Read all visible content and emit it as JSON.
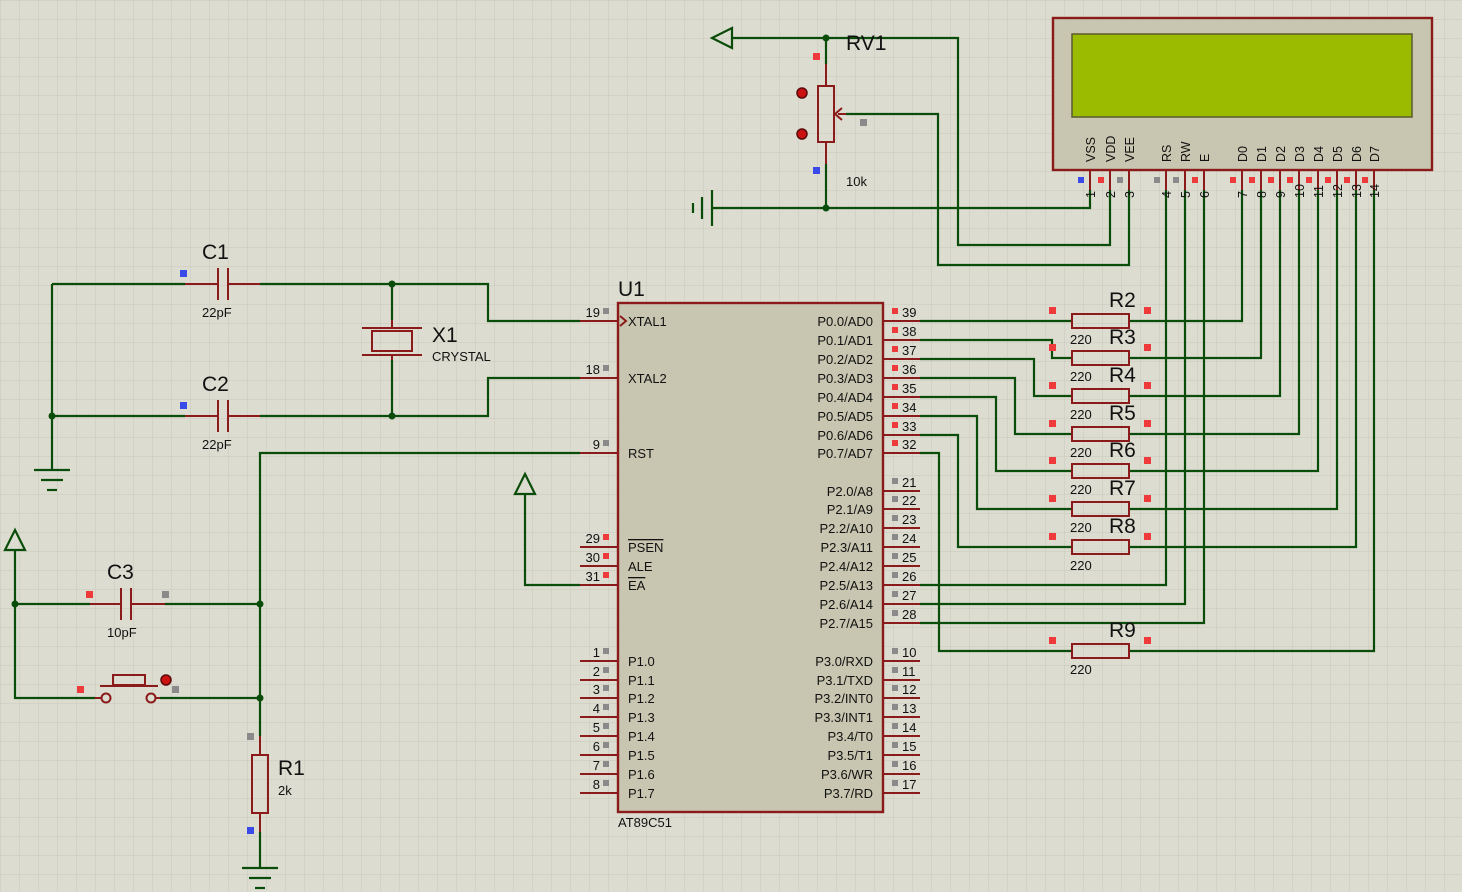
{
  "colors": {
    "background": "#dcdcd0",
    "grid": "#c9c9bd",
    "wire": "#0a4d0a",
    "component": "#8b1a1a",
    "body": "#c8c6b0",
    "lcd_screen": "#9bbb00",
    "lcd_body": "#c8c6b0"
  },
  "components": {
    "c1": {
      "ref": "C1",
      "value": "22pF"
    },
    "c2": {
      "ref": "C2",
      "value": "22pF"
    },
    "c3": {
      "ref": "C3",
      "value": "10pF"
    },
    "x1": {
      "ref": "X1",
      "value": "CRYSTAL"
    },
    "r1": {
      "ref": "R1",
      "value": "2k"
    },
    "rv1": {
      "ref": "RV1",
      "value": "10k"
    },
    "u1": {
      "ref": "U1",
      "part": "AT89C51"
    },
    "resistors": [
      {
        "ref": "R2",
        "value": "220"
      },
      {
        "ref": "R3",
        "value": "220"
      },
      {
        "ref": "R4",
        "value": "220"
      },
      {
        "ref": "R5",
        "value": "220"
      },
      {
        "ref": "R6",
        "value": "220"
      },
      {
        "ref": "R7",
        "value": "220"
      },
      {
        "ref": "R8",
        "value": "220"
      },
      {
        "ref": "R9",
        "value": "220"
      }
    ]
  },
  "mcu": {
    "left_pins": [
      {
        "num": "19",
        "label": "XTAL1"
      },
      {
        "num": "18",
        "label": "XTAL2"
      },
      {
        "num": "9",
        "label": "RST"
      },
      {
        "num": "29",
        "label": "PSEN",
        "overline": true
      },
      {
        "num": "30",
        "label": "ALE"
      },
      {
        "num": "31",
        "label": "EA",
        "overline": true
      },
      {
        "num": "1",
        "label": "P1.0"
      },
      {
        "num": "2",
        "label": "P1.1"
      },
      {
        "num": "3",
        "label": "P1.2"
      },
      {
        "num": "4",
        "label": "P1.3"
      },
      {
        "num": "5",
        "label": "P1.4"
      },
      {
        "num": "6",
        "label": "P1.5"
      },
      {
        "num": "7",
        "label": "P1.6"
      },
      {
        "num": "8",
        "label": "P1.7"
      }
    ],
    "right_pins": [
      {
        "num": "39",
        "label": "P0.0/AD0"
      },
      {
        "num": "38",
        "label": "P0.1/AD1"
      },
      {
        "num": "37",
        "label": "P0.2/AD2"
      },
      {
        "num": "36",
        "label": "P0.3/AD3"
      },
      {
        "num": "35",
        "label": "P0.4/AD4"
      },
      {
        "num": "34",
        "label": "P0.5/AD5"
      },
      {
        "num": "33",
        "label": "P0.6/AD6"
      },
      {
        "num": "32",
        "label": "P0.7/AD7"
      },
      {
        "num": "21",
        "label": "P2.0/A8"
      },
      {
        "num": "22",
        "label": "P2.1/A9"
      },
      {
        "num": "23",
        "label": "P2.2/A10"
      },
      {
        "num": "24",
        "label": "P2.3/A11"
      },
      {
        "num": "25",
        "label": "P2.4/A12"
      },
      {
        "num": "26",
        "label": "P2.5/A13"
      },
      {
        "num": "27",
        "label": "P2.6/A14"
      },
      {
        "num": "28",
        "label": "P2.7/A15"
      },
      {
        "num": "10",
        "label": "P3.0/RXD"
      },
      {
        "num": "11",
        "label": "P3.1/TXD"
      },
      {
        "num": "12",
        "label": "P3.2/INT0"
      },
      {
        "num": "13",
        "label": "P3.3/INT1"
      },
      {
        "num": "14",
        "label": "P3.4/T0"
      },
      {
        "num": "15",
        "label": "P3.5/T1"
      },
      {
        "num": "16",
        "label": "P3.6/WR"
      },
      {
        "num": "17",
        "label": "P3.7/RD"
      }
    ]
  },
  "lcd": {
    "pins": [
      {
        "num": "1",
        "label": "VSS"
      },
      {
        "num": "2",
        "label": "VDD"
      },
      {
        "num": "3",
        "label": "VEE"
      },
      {
        "num": "4",
        "label": "RS"
      },
      {
        "num": "5",
        "label": "RW"
      },
      {
        "num": "6",
        "label": "E"
      },
      {
        "num": "7",
        "label": "D0"
      },
      {
        "num": "8",
        "label": "D1"
      },
      {
        "num": "9",
        "label": "D2"
      },
      {
        "num": "10",
        "label": "D3"
      },
      {
        "num": "11",
        "label": "D4"
      },
      {
        "num": "12",
        "label": "D5"
      },
      {
        "num": "13",
        "label": "D6"
      },
      {
        "num": "14",
        "label": "D7"
      }
    ]
  }
}
